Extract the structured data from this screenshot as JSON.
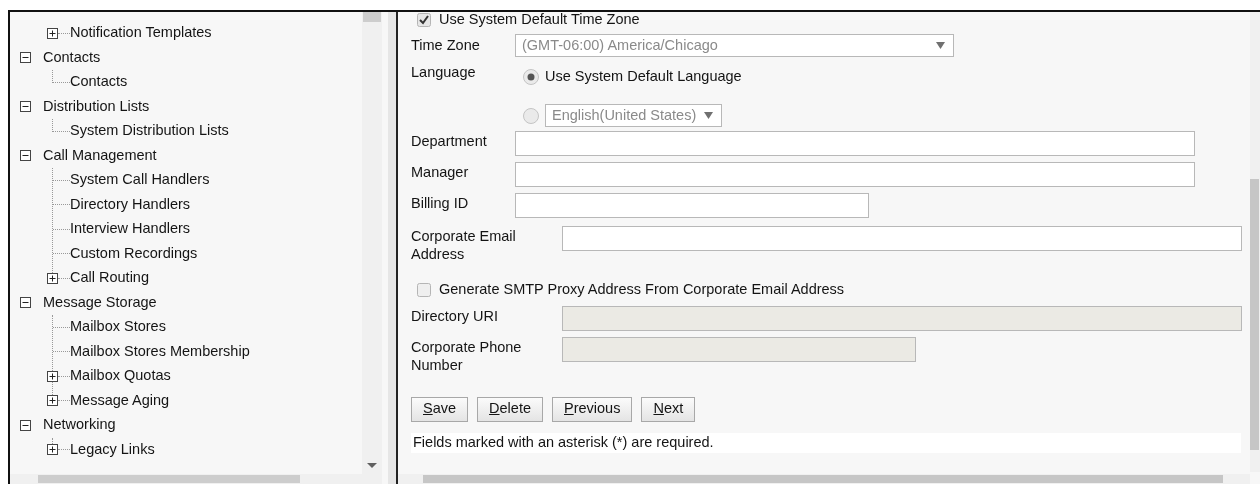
{
  "partial_branch": [
    {
      "label": "Notification Templates",
      "expanded": false
    }
  ],
  "tree": [
    {
      "label": "Contacts",
      "expanded": true,
      "children": [
        {
          "label": "Contacts"
        }
      ]
    },
    {
      "label": "Distribution Lists",
      "expanded": true,
      "children": [
        {
          "label": "System Distribution Lists"
        }
      ]
    },
    {
      "label": "Call Management",
      "expanded": true,
      "children": [
        {
          "label": "System Call Handlers"
        },
        {
          "label": "Directory Handlers"
        },
        {
          "label": "Interview Handlers"
        },
        {
          "label": "Custom Recordings"
        },
        {
          "label": "Call Routing",
          "expanded": false
        }
      ]
    },
    {
      "label": "Message Storage",
      "expanded": true,
      "children": [
        {
          "label": "Mailbox Stores"
        },
        {
          "label": "Mailbox Stores Membership"
        },
        {
          "label": "Mailbox Quotas",
          "expanded": false
        },
        {
          "label": "Message Aging",
          "expanded": false
        }
      ]
    },
    {
      "label": "Networking",
      "expanded": true,
      "children": [
        {
          "label": "Legacy Links",
          "expanded": false
        }
      ]
    }
  ],
  "form": {
    "use_system_time_zone": {
      "label": "Use System Default Time Zone",
      "checked": true
    },
    "time_zone": {
      "label": "Time Zone",
      "value": "(GMT-06:00) America/Chicago",
      "disabled": true
    },
    "language": {
      "label": "Language",
      "options": [
        {
          "kind": "text",
          "label": "Use System Default Language",
          "selected": true
        },
        {
          "kind": "select",
          "value": "English(United States)",
          "selected": false
        }
      ]
    },
    "department": {
      "label": "Department",
      "disabled": false
    },
    "manager": {
      "label": "Manager",
      "disabled": false
    },
    "billing_id": {
      "label": "Billing ID",
      "disabled": false
    },
    "corporate_email": {
      "label": "Corporate Email Address",
      "disabled": false
    },
    "generate_smtp": {
      "label": "Generate SMTP Proxy Address From Corporate Email Address",
      "checked": false
    },
    "directory_uri": {
      "label": "Directory URI",
      "disabled": true
    },
    "corporate_phone": {
      "label": "Corporate Phone Number",
      "disabled": true
    }
  },
  "buttons": [
    "Save",
    "Delete",
    "Previous",
    "Next"
  ],
  "note": "Fields marked with an asterisk (*) are required."
}
